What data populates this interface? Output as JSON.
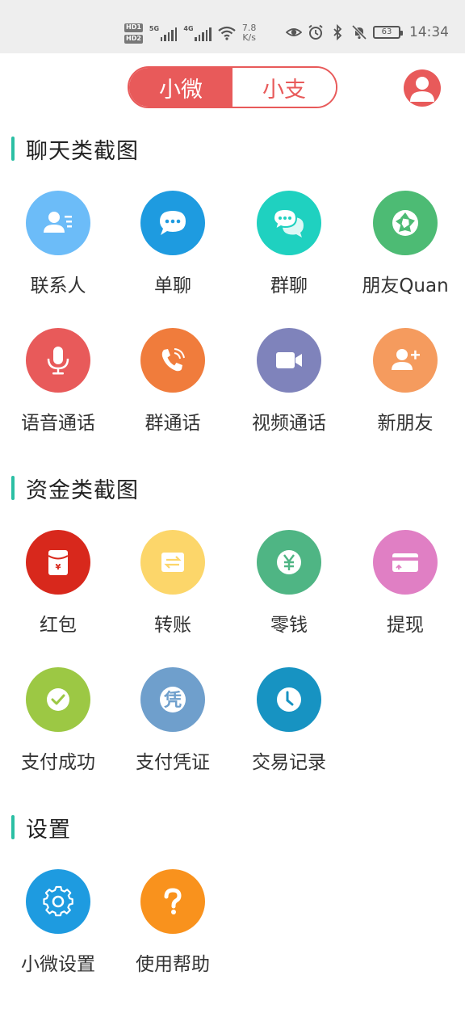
{
  "status_bar": {
    "sim1": "HD1",
    "sim2": "HD2",
    "gen1": "5G",
    "gen2": "4G",
    "speed_value": "7.8",
    "speed_unit": "K/s",
    "battery": "63",
    "time": "14:34"
  },
  "header": {
    "tab_active": "小微",
    "tab_inactive": "小支"
  },
  "sections": {
    "chat": {
      "title": "聊天类截图",
      "items": [
        "联系人",
        "单聊",
        "群聊",
        "朋友Quan",
        "语音通话",
        "群通话",
        "视频通话",
        "新朋友"
      ]
    },
    "money": {
      "title": "资金类截图",
      "items": [
        "红包",
        "转账",
        "零钱",
        "提现",
        "支付成功",
        "支付凭证",
        "交易记录"
      ]
    },
    "settings": {
      "title": "设置",
      "items": [
        "小微设置",
        "使用帮助"
      ]
    }
  },
  "icons": {
    "contacts": "contact-card-icon",
    "single_chat": "chat-bubble-icon",
    "group_chat": "double-chat-bubble-icon",
    "moments": "aperture-icon",
    "voice_call": "microphone-icon",
    "group_call": "phone-ringing-icon",
    "video_call": "video-camera-icon",
    "new_friend": "add-person-icon",
    "red_packet": "red-envelope-icon",
    "transfer": "transfer-arrows-icon",
    "wallet": "yen-coin-icon",
    "withdraw": "bank-card-icon",
    "pay_success": "check-circle-icon",
    "pay_voucher": "voucher-icon",
    "transactions": "clock-icon",
    "settings": "gear-icon",
    "help": "question-mark-icon"
  },
  "colors": {
    "accent": "#e85a5a",
    "section_bar": "#2bbfa4",
    "contacts": "#6cbcf8",
    "single_chat": "#1e9be0",
    "group_chat": "#1fd1c0",
    "moments": "#4dbb74",
    "voice_call": "#e85a5a",
    "group_call": "#f07c3c",
    "video_call": "#7f83bb",
    "new_friend": "#f59b5e",
    "red_packet": "#d8281c",
    "transfer": "#fcd66a",
    "wallet": "#4fb584",
    "withdraw": "#e07fc4",
    "pay_success": "#9cc844",
    "pay_voucher": "#6f9fcc",
    "transactions": "#1793c2",
    "settings": "#1e9be0",
    "help": "#f9921d"
  }
}
